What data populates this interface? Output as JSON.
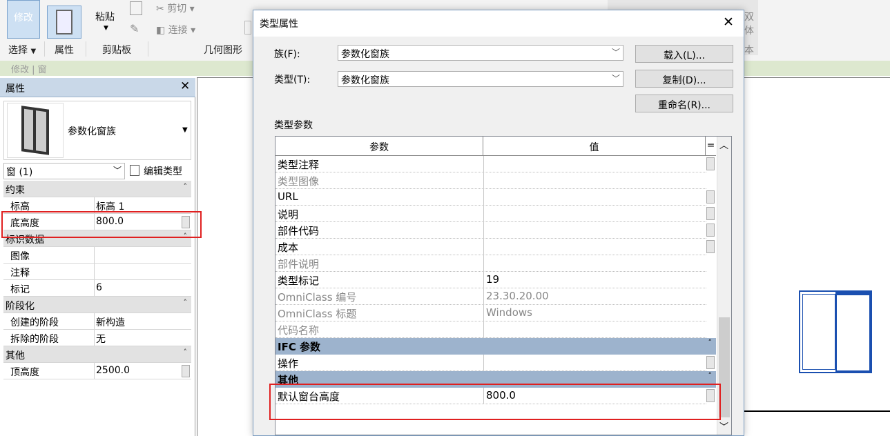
{
  "ribbon": {
    "modify": "修改",
    "paste": "粘贴",
    "cut": "剪切",
    "join": "连接",
    "select": "选择",
    "properties": "属性",
    "clipboard": "剪贴板",
    "geometry": "几何图形",
    "right_char_1": "双",
    "right_char_2": "体",
    "right_char_3": "本"
  },
  "context_bar": "修改 | 窗",
  "props": {
    "title": "属性",
    "family_name": "参数化窗族",
    "instance_filter": "窗 (1)",
    "edit_type": "编辑类型",
    "rows": [
      {
        "kind": "cat",
        "name": "约束",
        "chevron": "˄"
      },
      {
        "kind": "row",
        "name": "标高",
        "value": "标高 1"
      },
      {
        "kind": "row",
        "name": "底高度",
        "value": "800.0",
        "btn": true
      },
      {
        "kind": "cat",
        "name": "标识数据",
        "chevron": "˄"
      },
      {
        "kind": "row",
        "name": "图像",
        "value": ""
      },
      {
        "kind": "row",
        "name": "注释",
        "value": ""
      },
      {
        "kind": "row",
        "name": "标记",
        "value": "6"
      },
      {
        "kind": "cat",
        "name": "阶段化",
        "chevron": "˄"
      },
      {
        "kind": "row",
        "name": "创建的阶段",
        "value": "新构造"
      },
      {
        "kind": "row",
        "name": "拆除的阶段",
        "value": "无"
      },
      {
        "kind": "cat",
        "name": "其他",
        "chevron": "˄"
      },
      {
        "kind": "row",
        "name": "顶高度",
        "value": "2500.0",
        "btn": true
      }
    ]
  },
  "dialog": {
    "title": "类型属性",
    "family_label": "族(F):",
    "family_value": "参数化窗族",
    "type_label": "类型(T):",
    "type_value": "参数化窗族",
    "load_btn": "载入(L)...",
    "dup_btn": "复制(D)...",
    "rename_btn": "重命名(R)...",
    "type_params": "类型参数",
    "col_param": "参数",
    "col_value": "值",
    "col_eq": "=",
    "rows": [
      {
        "kind": "row",
        "name": "类型注释",
        "value": "",
        "btn": true
      },
      {
        "kind": "row",
        "name": "类型图像",
        "value": "",
        "grey": true
      },
      {
        "kind": "row",
        "name": "URL",
        "value": "",
        "btn": true
      },
      {
        "kind": "row",
        "name": "说明",
        "value": "",
        "btn": true
      },
      {
        "kind": "row",
        "name": "部件代码",
        "value": "",
        "btn": true
      },
      {
        "kind": "row",
        "name": "成本",
        "value": "",
        "btn": true
      },
      {
        "kind": "row",
        "name": "部件说明",
        "value": "",
        "grey": true
      },
      {
        "kind": "row",
        "name": "类型标记",
        "value": "19"
      },
      {
        "kind": "row",
        "name": "OmniClass 编号",
        "value": "23.30.20.00",
        "grey": true
      },
      {
        "kind": "row",
        "name": "OmniClass 标题",
        "value": "Windows",
        "grey": true
      },
      {
        "kind": "row",
        "name": "代码名称",
        "value": "",
        "grey": true
      },
      {
        "kind": "cat",
        "name": "IFC 参数",
        "chevron": "˄"
      },
      {
        "kind": "row",
        "name": "操作",
        "value": "",
        "btn": true
      },
      {
        "kind": "cat",
        "name": "其他",
        "chevron": "˄"
      },
      {
        "kind": "row",
        "name": "默认窗台高度",
        "value": "800.0",
        "btn": true
      }
    ]
  },
  "colors": {
    "highlight": "#e02020",
    "category_blue": "#9db3cd",
    "ribbon_bg": "#f3f3f3",
    "context_green": "#dde8cf"
  }
}
